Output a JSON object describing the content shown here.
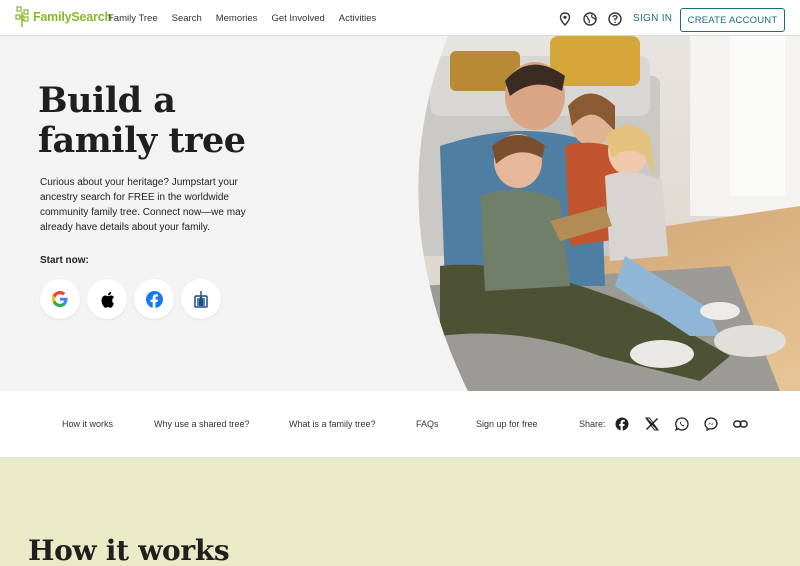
{
  "header": {
    "logo_text": "FamilySearch",
    "nav": [
      "Family Tree",
      "Search",
      "Memories",
      "Get Involved",
      "Activities"
    ],
    "icons": [
      "location-pin-icon",
      "globe-icon",
      "help-icon"
    ],
    "sign_in": "SIGN IN",
    "create_account": "CREATE ACCOUNT"
  },
  "hero": {
    "title_line1": "Build a",
    "title_line2": "family tree",
    "description": "Curious about your heritage? Jumpstart your ancestry search for FREE in the worldwide community family tree. Connect now—we may already have details about your family.",
    "start_now": "Start now:",
    "social_buttons": [
      "google-icon",
      "apple-icon",
      "facebook-icon",
      "church-account-icon"
    ]
  },
  "section_nav": {
    "items": [
      "How it works",
      "Why use a shared tree?",
      "What is a family tree?",
      "FAQs",
      "Sign up for free"
    ],
    "share_label": "Share:",
    "share_icons": [
      "facebook-icon",
      "x-icon",
      "whatsapp-icon",
      "messenger-icon",
      "link-icon"
    ]
  },
  "how_it_works": {
    "title": "How it works"
  },
  "colors": {
    "brand_green": "#87b828",
    "link_blue": "#1a6b8a",
    "hero_bg": "#f3f3f3",
    "section_bg": "#e9ebc6"
  }
}
